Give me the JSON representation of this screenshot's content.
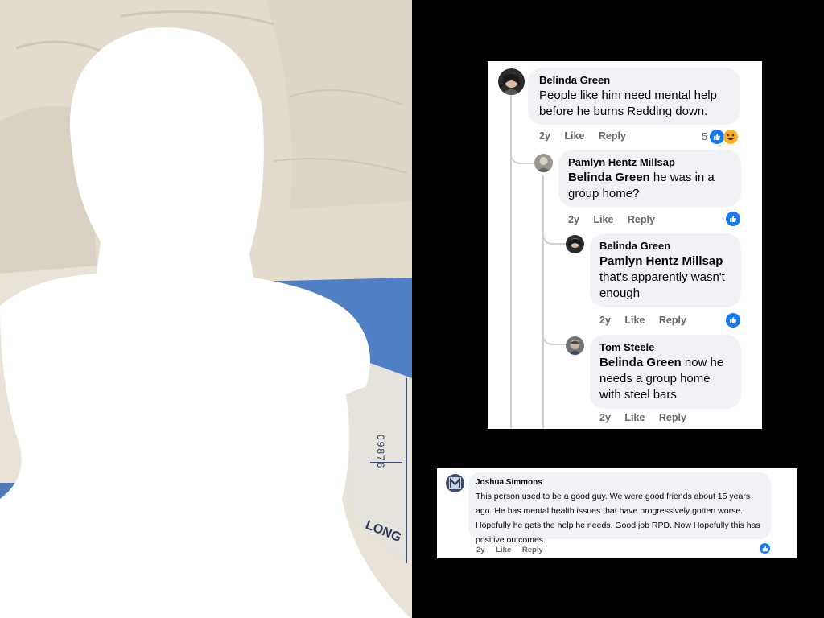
{
  "photo": {
    "wristband_number": "09876",
    "wristband_brand": "LONG"
  },
  "thread1": {
    "comments": [
      {
        "author": "Belinda Green",
        "text": "People like him need mental help before he burns Redding down.",
        "time": "2y",
        "like": "Like",
        "reply": "Reply",
        "reaction_count": "5"
      },
      {
        "author": "Pamlyn Hentz Millsap",
        "mention": "Belinda Green",
        "text": " he was in a group home?",
        "time": "2y",
        "like": "Like",
        "reply": "Reply"
      },
      {
        "author": "Belinda Green",
        "mention": "Pamlyn Hentz Millsap",
        "text": "that's apparently wasn't enough",
        "time": "2y",
        "like": "Like",
        "reply": "Reply"
      },
      {
        "author": "Tom Steele",
        "mention": "Belinda Green",
        "text": " now he needs a group home with steel bars",
        "time": "2y",
        "like": "Like",
        "reply": "Reply"
      }
    ]
  },
  "thread2": {
    "comment": {
      "author": "Joshua Simmons",
      "text": "This person used to be a good guy. We were good friends about 15 years ago. He has mental health issues that have progressively gotten worse. Hopefully he gets the help he needs. Good job RPD. Now Hopefully this has positive outcomes.",
      "time": "2y",
      "like": "Like",
      "reply": "Reply"
    }
  },
  "colors": {
    "bubble": "#f0f2f5",
    "meta_text": "#65676b",
    "like_blue": "#1877f2",
    "background": "#000000"
  }
}
